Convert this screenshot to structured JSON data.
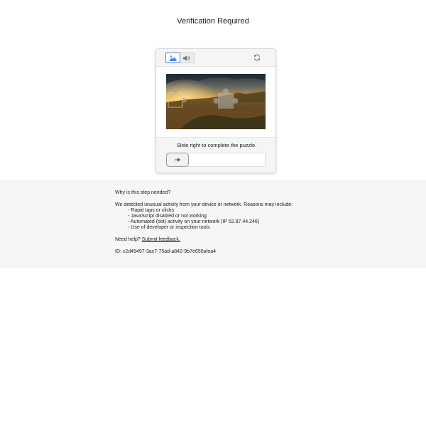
{
  "page": {
    "title": "Verification Required"
  },
  "captcha": {
    "mode_toggle": {
      "selected": "image",
      "options": [
        "image-icon",
        "audio-icon"
      ]
    },
    "refresh_icon": "refresh-icon",
    "instruction": "Slide right to complete the puzzle.",
    "slider": {
      "handle_icon": "arrow-right-icon",
      "progress": 0
    },
    "colors": {
      "accent": "#4a86e8",
      "header_bg": "#f5f5f5"
    }
  },
  "info": {
    "question": "Why is this step needed?",
    "intro": "We detected unusual activity from your device or network. Reasons may include:",
    "reasons": [
      "Rapid taps or clicks",
      "JavaScript disabled or not working",
      "Automated (bot) activity on your network (IP 52.87.44.246)",
      "Use of developer or inspection tools"
    ],
    "help_prefix": "Need help?",
    "help_link": "Submit feedback.",
    "id_line": "ID: c2d49497-3ac7-75ad-a842-9b7e650afea4"
  }
}
